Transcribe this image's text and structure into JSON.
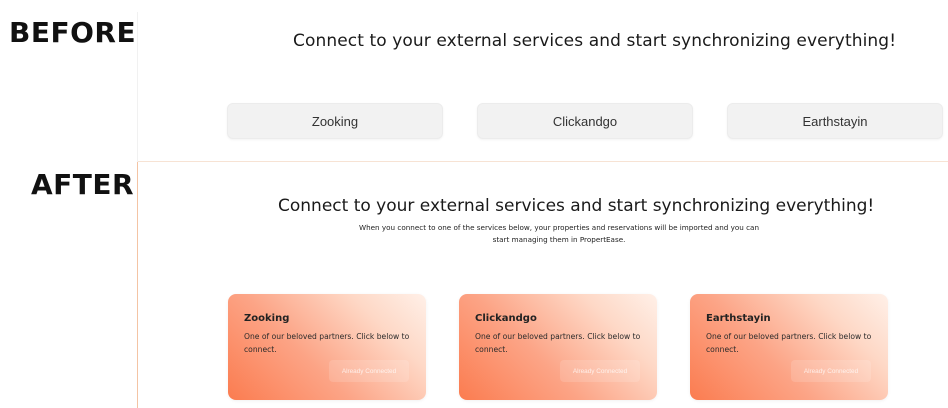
{
  "labels": {
    "before": "BEFORE",
    "after": "AFTER"
  },
  "before": {
    "headline": "Connect to your external services and start synchronizing everything!",
    "services": [
      "Zooking",
      "Clickandgo",
      "Earthstayin"
    ]
  },
  "after": {
    "headline": "Connect to your external services and start synchronizing everything!",
    "subtext_line1": "When you connect to one of the services below, your properties and reservations will be imported and you can",
    "subtext_line2": "start managing them in PropertEase.",
    "cards": [
      {
        "title": "Zooking",
        "description": "One of our beloved partners. Click below to connect.",
        "button": "Already Connected"
      },
      {
        "title": "Clickandgo",
        "description": "One of our beloved partners. Click below to connect.",
        "button": "Already Connected"
      },
      {
        "title": "Earthstayin",
        "description": "One of our beloved partners. Click below to connect.",
        "button": "Already Connected"
      }
    ]
  },
  "colors": {
    "card_gradient_start": "#fb7c50",
    "card_gradient_end": "#fff0e8",
    "button_gray": "#f2f2f2"
  }
}
